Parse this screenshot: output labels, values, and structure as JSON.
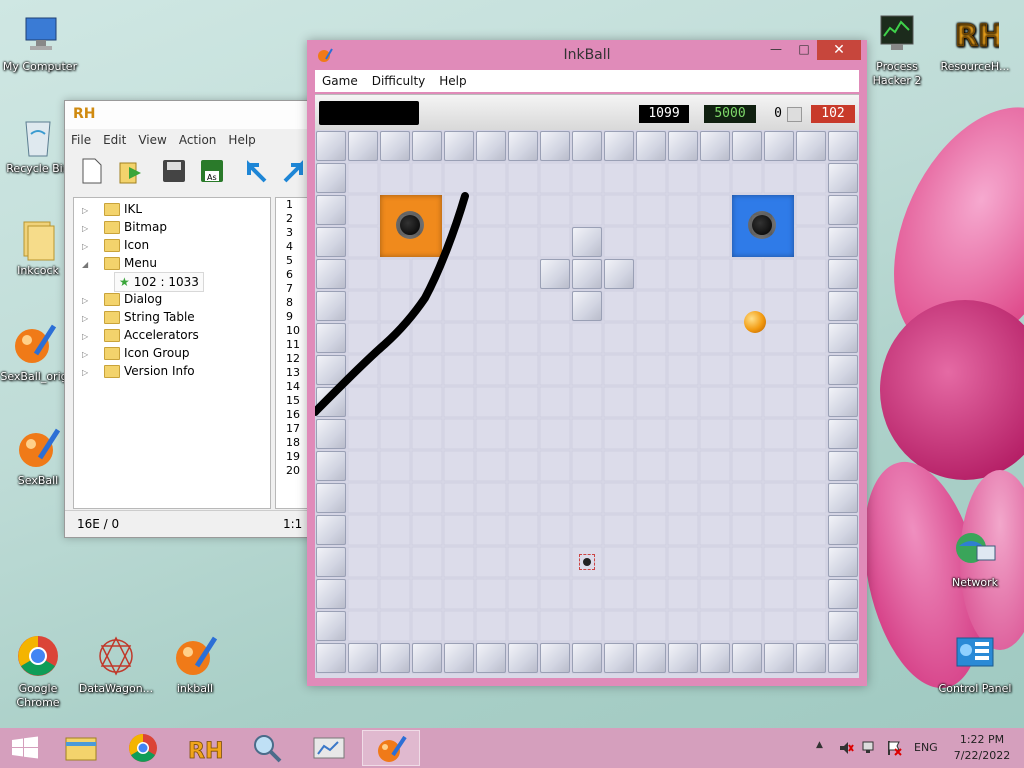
{
  "desktop": {
    "icons": [
      {
        "label": "My Computer",
        "icon": "computer-icon"
      },
      {
        "label": "Recycle Bin",
        "icon": "recycle-bin-icon"
      },
      {
        "label": "Inkcock",
        "icon": "folder-icon"
      },
      {
        "label": "SexBall_orig",
        "icon": "inkball-icon"
      },
      {
        "label": "SexBall",
        "icon": "inkball-icon"
      },
      {
        "label": "Google Chrome",
        "icon": "chrome-icon"
      },
      {
        "label": "DataWagon...",
        "icon": "datawagon-icon"
      },
      {
        "label": "inkball",
        "icon": "inkball-icon"
      },
      {
        "label": "Process Hacker 2",
        "icon": "process-hacker-icon"
      },
      {
        "label": "ResourceH...",
        "icon": "resource-hacker-icon"
      },
      {
        "label": "Network",
        "icon": "network-icon"
      },
      {
        "label": "Control Panel",
        "icon": "control-panel-icon"
      }
    ]
  },
  "rh_window": {
    "title_logo": "RH",
    "menu": [
      "File",
      "Edit",
      "View",
      "Action",
      "Help"
    ],
    "tree": [
      {
        "label": "IKL",
        "type": "folder",
        "expanded": false
      },
      {
        "label": "Bitmap",
        "type": "folder",
        "expanded": false
      },
      {
        "label": "Icon",
        "type": "folder",
        "expanded": false
      },
      {
        "label": "Menu",
        "type": "folder",
        "expanded": true
      },
      {
        "label": "102 : 1033",
        "type": "star",
        "child": true
      },
      {
        "label": "Dialog",
        "type": "folder",
        "expanded": false
      },
      {
        "label": "String Table",
        "type": "folder",
        "expanded": false
      },
      {
        "label": "Accelerators",
        "type": "folder",
        "expanded": false
      },
      {
        "label": "Icon Group",
        "type": "folder",
        "expanded": false
      },
      {
        "label": "Version Info",
        "type": "folder",
        "expanded": false
      }
    ],
    "line_numbers": [
      "1",
      "2",
      "3",
      "4",
      "5",
      "6",
      "7",
      "8",
      "9",
      "10",
      "11",
      "12",
      "13",
      "14",
      "15",
      "16",
      "17",
      "18",
      "19",
      "20"
    ],
    "status_left": "16E / 0",
    "status_right": "1:1"
  },
  "inkball": {
    "title": "InkBall",
    "menu": [
      "Game",
      "Difficulty",
      "Help"
    ],
    "scores": {
      "time": "1099",
      "target": "5000",
      "balls_count": "0",
      "score": "102"
    },
    "colors": {
      "frame": "#e08bb9",
      "orange_hole": "#f08a1c",
      "blue_hole": "#2f7be8",
      "ball": "#f29a10",
      "ink_line": "#000000"
    }
  },
  "taskbar": {
    "items": [
      "file-explorer-icon",
      "chrome-icon",
      "resource-hacker-icon",
      "search-magnifier-icon",
      "presentation-icon",
      "inkball-icon"
    ],
    "language": "ENG",
    "time": "1:22 PM",
    "date": "7/22/2022"
  }
}
